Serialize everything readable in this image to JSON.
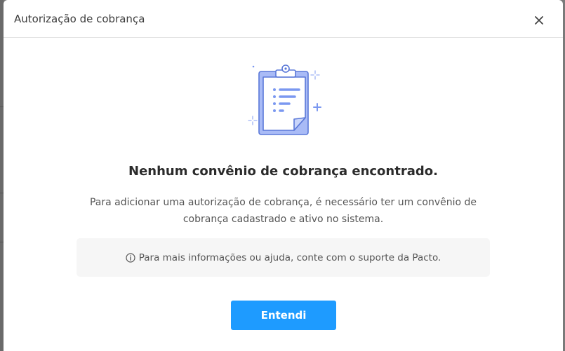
{
  "modal": {
    "title": "Autorização de cobrança",
    "close_icon": "close-icon",
    "illustration_icon": "clipboard-icon",
    "empty_title": "Nenhum convênio de cobrança encontrado.",
    "empty_description": "Para adicionar uma autorização de cobrança, é necessário ter um convênio de cobrança cadastrado e ativo no sistema.",
    "info_icon": "info-icon",
    "info_text": "Para mais informações ou ajuda, conte com o suporte da Pacto.",
    "confirm_label": "Entendi"
  },
  "colors": {
    "primary": "#1e9bff",
    "illustration": "#7b98f0",
    "title_text": "#2b2b2b",
    "body_text": "#555555",
    "info_bg": "#f6f6f6"
  }
}
